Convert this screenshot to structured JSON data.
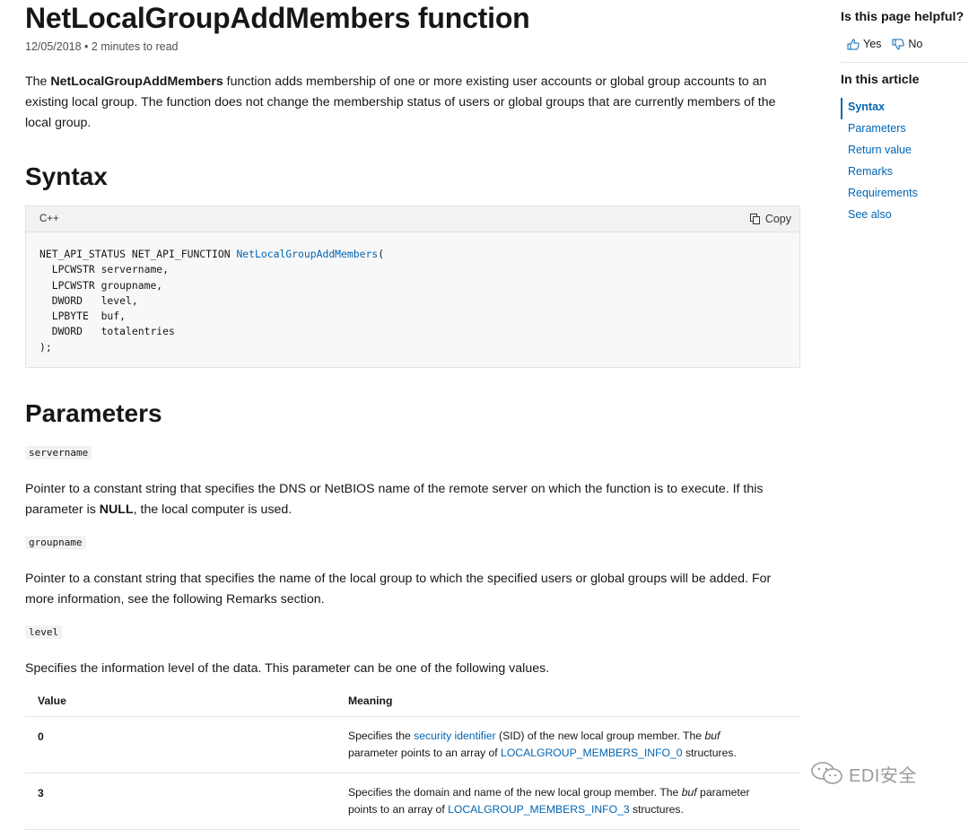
{
  "page": {
    "title": "NetLocalGroupAddMembers function",
    "date": "12/05/2018",
    "read_time": "2 minutes to read",
    "intro": {
      "pre": "The ",
      "bold": "NetLocalGroupAddMembers",
      "post": " function adds membership of one or more existing user accounts or global group accounts to an existing local group. The function does not change the membership status of users or global groups that are currently members of the local group."
    }
  },
  "syntax": {
    "heading": "Syntax",
    "language": "C++",
    "copy_label": "Copy",
    "code_prefix": "NET_API_STATUS NET_API_FUNCTION ",
    "code_function": "NetLocalGroupAddMembers",
    "code_rest": "(\n  LPCWSTR servername,\n  LPCWSTR groupname,\n  DWORD   level,\n  LPBYTE  buf,\n  DWORD   totalentries\n);"
  },
  "parameters": {
    "heading": "Parameters",
    "servername": {
      "name": "servername",
      "desc_pre": "Pointer to a constant string that specifies the DNS or NetBIOS name of the remote server on which the function is to execute. If this parameter is ",
      "desc_bold": "NULL",
      "desc_post": ", the local computer is used."
    },
    "groupname": {
      "name": "groupname",
      "desc": "Pointer to a constant string that specifies the name of the local group to which the specified users or global groups will be added. For more information, see the following Remarks section."
    },
    "level": {
      "name": "level",
      "desc": "Specifies the information level of the data. This parameter can be one of the following values."
    },
    "table": {
      "headers": [
        "Value",
        "Meaning"
      ],
      "rows": [
        {
          "value": "0",
          "m1": "Specifies the ",
          "link1": "security identifier",
          "m2": " (SID) of the new local group member. The ",
          "em": "buf",
          "m3": " parameter points to an array of ",
          "link2": "LOCALGROUP_MEMBERS_INFO_0",
          "m4": " structures."
        },
        {
          "value": "3",
          "m1": "Specifies the domain and name of the new local group member. The ",
          "em": "buf",
          "m2": " parameter points to an array of ",
          "link2": "LOCALGROUP_MEMBERS_INFO_3",
          "m3": " structures."
        }
      ]
    }
  },
  "sidebar": {
    "helpful_label": "Is this page helpful?",
    "yes_label": "Yes",
    "no_label": "No",
    "in_article_label": "In this article",
    "toc": [
      "Syntax",
      "Parameters",
      "Return value",
      "Remarks",
      "Requirements",
      "See also"
    ],
    "active_index": 0
  },
  "watermark": {
    "text": "EDI安全"
  }
}
